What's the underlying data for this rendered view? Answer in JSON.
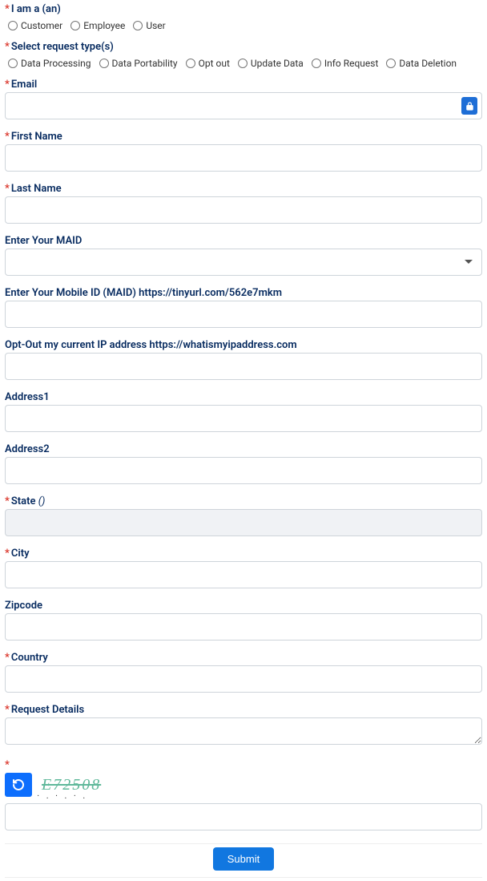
{
  "iam": {
    "label": "I am a (an)",
    "options": [
      "Customer",
      "Employee",
      "User"
    ]
  },
  "reqtype": {
    "label": "Select request type(s)",
    "options": [
      "Data Processing",
      "Data Portability",
      "Opt out",
      "Update Data",
      "Info Request",
      "Data Deletion"
    ]
  },
  "fields": {
    "email": {
      "label": "Email",
      "required": true
    },
    "first_name": {
      "label": "First Name",
      "required": true
    },
    "last_name": {
      "label": "Last Name",
      "required": true
    },
    "maid": {
      "label": "Enter Your MAID",
      "required": false
    },
    "mobile_id": {
      "label": "Enter Your Mobile ID (MAID) https://tinyurl.com/562e7mkm",
      "required": false
    },
    "optout_ip": {
      "label": "Opt-Out my current IP address https://whatismyipaddress.com",
      "required": false
    },
    "address1": {
      "label": "Address1",
      "required": false
    },
    "address2": {
      "label": "Address2",
      "required": false
    },
    "state": {
      "label": "State",
      "suffix": "()",
      "required": true
    },
    "city": {
      "label": "City",
      "required": true
    },
    "zipcode": {
      "label": "Zipcode",
      "required": false
    },
    "country": {
      "label": "Country",
      "required": true
    },
    "details": {
      "label": "Request Details",
      "required": true
    }
  },
  "captcha": {
    "text": "E72508"
  },
  "buttons": {
    "submit": "Submit"
  }
}
